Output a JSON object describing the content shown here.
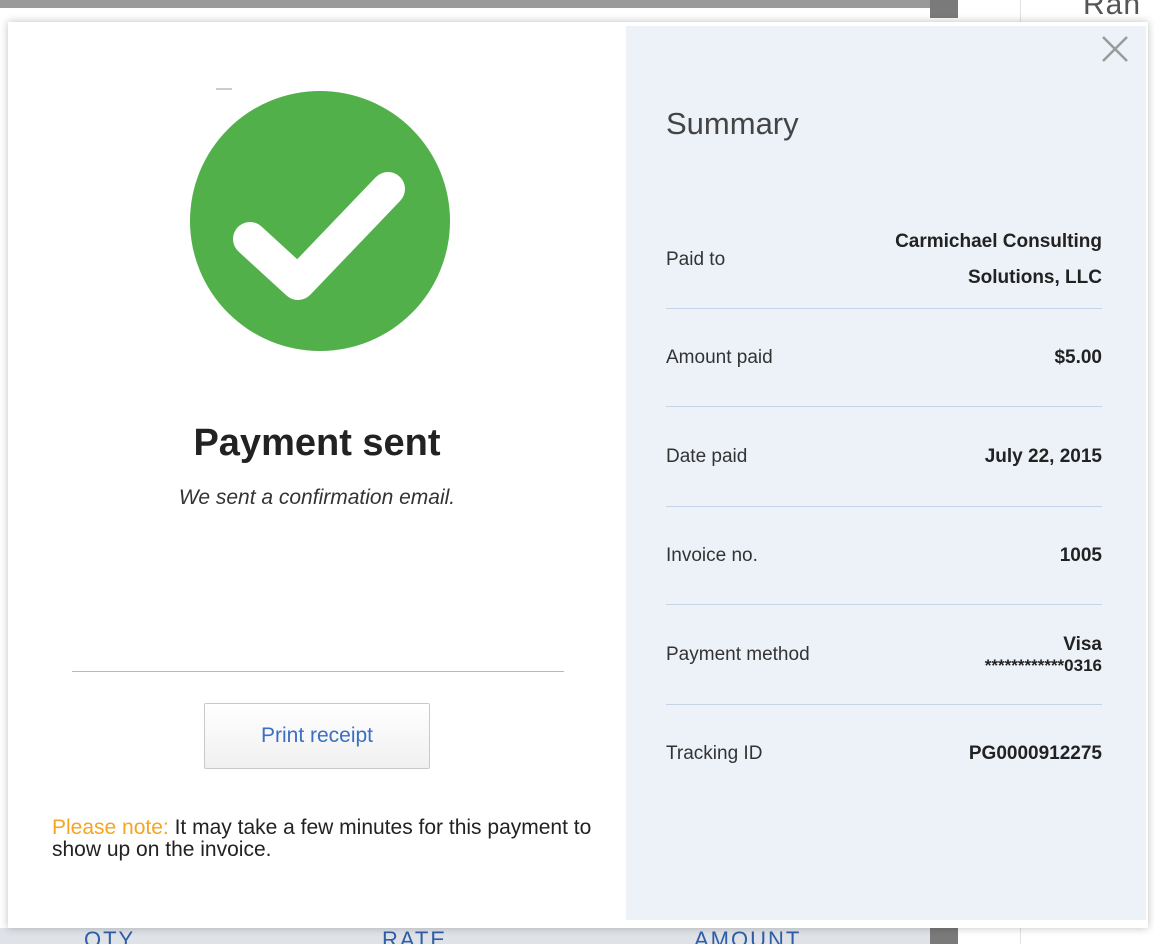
{
  "background": {
    "header_text": "Ran",
    "columns": [
      "QTY",
      "RATE",
      "AMOUNT"
    ]
  },
  "modal": {
    "status_title": "Payment sent",
    "status_subtitle": "We sent a confirmation email.",
    "print_button_label": "Print receipt",
    "note_label": "Please note:",
    "note_text": " It may take a few minutes for this payment to show up on the invoice.",
    "icons": {
      "success": "check-circle-icon",
      "close": "close-icon"
    },
    "colors": {
      "success": "#52b04b",
      "link": "#3a6fc4",
      "note": "#f4a522",
      "panel": "#edf2f9"
    }
  },
  "summary": {
    "title": "Summary",
    "rows": [
      {
        "label": "Paid to",
        "value": "Carmichael Consulting Solutions, LLC"
      },
      {
        "label": "Amount paid",
        "value": "$5.00"
      },
      {
        "label": "Date paid",
        "value": "July 22, 2015"
      },
      {
        "label": "Invoice no.",
        "value": "1005"
      },
      {
        "label": "Payment method",
        "value": "Visa",
        "value_sub": "************0316"
      },
      {
        "label": "Tracking ID",
        "value": "PG0000912275"
      }
    ]
  }
}
